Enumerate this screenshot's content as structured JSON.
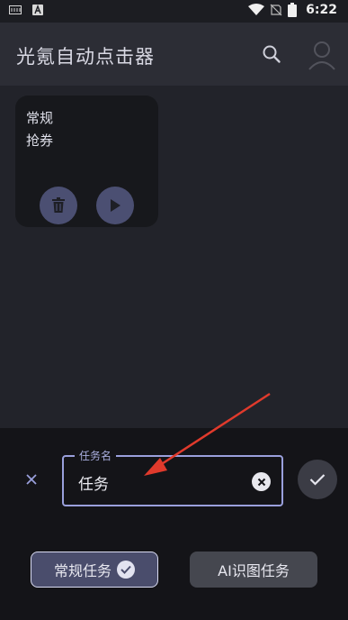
{
  "status_bar": {
    "time": "6:22",
    "icons": [
      "sim-icon",
      "a-notification-icon",
      "wifi-icon",
      "no-sim-icon",
      "battery-icon"
    ]
  },
  "app_bar": {
    "title": "光氪自动点击器",
    "search_icon": "search-icon"
  },
  "task_card": {
    "line1": "常规",
    "line2": "抢券",
    "delete_icon": "trash-icon",
    "play_icon": "play-icon"
  },
  "editor": {
    "field_label": "任务名",
    "field_value": "任务",
    "clear_icon": "clear-icon",
    "close_icon": "close-icon",
    "confirm_icon": "check-icon"
  },
  "type_options": [
    {
      "label": "常规任务",
      "selected": true
    },
    {
      "label": "AI识图任务",
      "selected": false
    }
  ],
  "colors": {
    "accent": "#9aa0dc",
    "chip_selected": "#4a4d6c",
    "annotation_arrow": "#e03a2c"
  }
}
